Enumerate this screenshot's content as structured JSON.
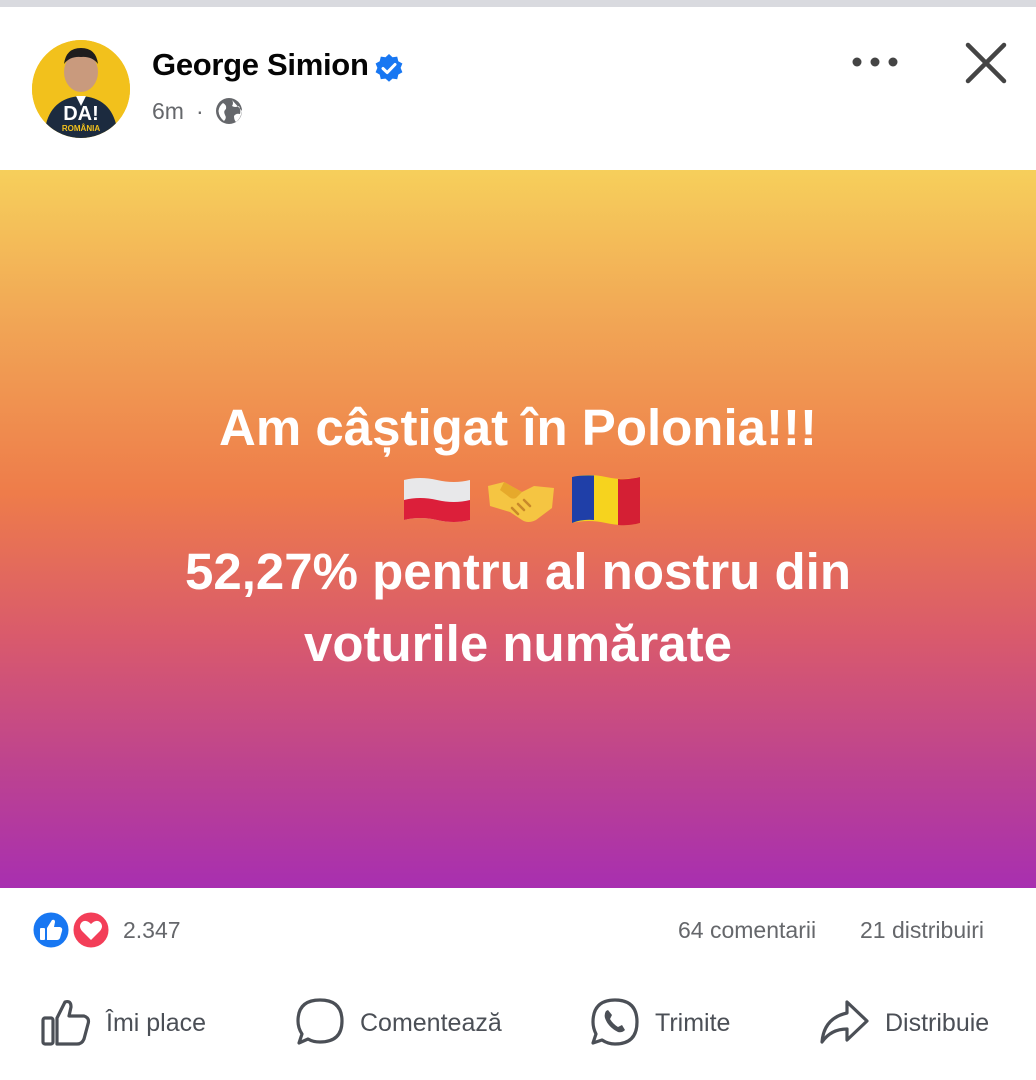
{
  "post": {
    "author": "George Simion",
    "time": "6m",
    "separator": "·",
    "avatar_text": "DA!",
    "avatar_subtext": "ROMÂNIA",
    "text_line1": "Am câștigat în Polonia!!!",
    "text_line2": "52,27% pentru al nostru din",
    "text_line3": "voturile numărate",
    "emojis": [
      "flag-poland-icon",
      "handshake-icon",
      "flag-romania-icon"
    ]
  },
  "stats": {
    "reactions": "2.347",
    "comments": "64 comentarii",
    "shares": "21 distribuiri"
  },
  "actions": {
    "like": "Îmi place",
    "comment": "Comentează",
    "send": "Trimite",
    "share": "Distribuie"
  },
  "colors": {
    "gradient_top": "#f6cf5b",
    "gradient_mid": "#ee7c4a",
    "gradient_bottom": "#a82fb0",
    "like_blue": "#1877f2",
    "love_red": "#f33e58",
    "verified_blue": "#1877f2"
  }
}
